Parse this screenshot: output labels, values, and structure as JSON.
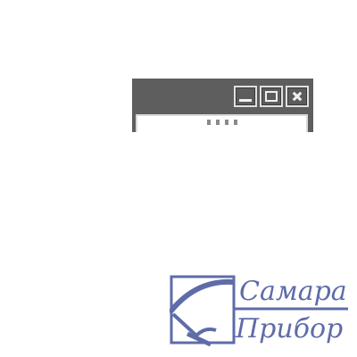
{
  "window": {
    "controls": [
      {
        "name": "minimize",
        "icon": "minimize-icon"
      },
      {
        "name": "restore",
        "icon": "restore-icon"
      },
      {
        "name": "close",
        "icon": "close-icon"
      }
    ]
  },
  "logo": {
    "line1": "Самара",
    "line2": "Прибор",
    "color": "#5e6ca8"
  }
}
